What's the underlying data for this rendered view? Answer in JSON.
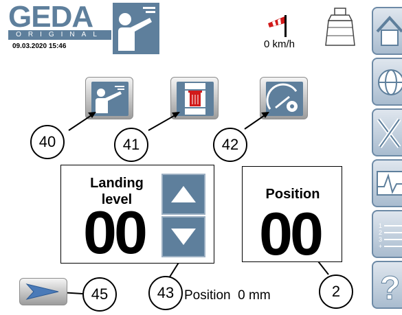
{
  "header": {
    "brand": "GEDA",
    "brand_sub": "ORIGINAL",
    "datetime": "09.03.2020   15:46",
    "wind_speed": "0 km/h"
  },
  "sidebar": {
    "items": [
      {
        "name": "home"
      },
      {
        "name": "language-globe"
      },
      {
        "name": "tools-settings"
      },
      {
        "name": "diagnostics"
      },
      {
        "name": "list"
      },
      {
        "name": "help"
      }
    ]
  },
  "toolbar": {
    "buttons": [
      {
        "name": "operator",
        "callout": "40"
      },
      {
        "name": "delete-landing",
        "callout": "41"
      },
      {
        "name": "gauge-settings",
        "callout": "42"
      }
    ]
  },
  "landing_panel": {
    "label_line1": "Landing",
    "label_line2": "level",
    "value": "00",
    "callout": "43"
  },
  "position_panel": {
    "label": "Position",
    "value": "00",
    "callout": "2"
  },
  "footer": {
    "send_callout": "45",
    "position_readout": "Position  0 mm"
  },
  "colors": {
    "accent": "#5e7f9c",
    "alert": "#d11a1a"
  }
}
